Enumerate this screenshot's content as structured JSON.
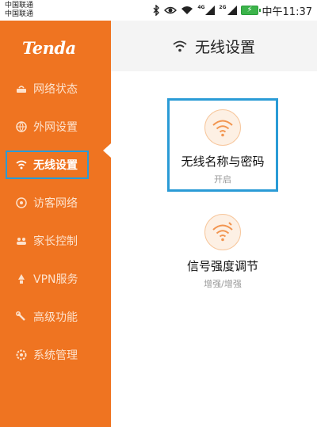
{
  "status_bar": {
    "carrier1": "中国联通",
    "carrier2": "中国联通",
    "net_tag1": "4G",
    "net_tag2": "2G",
    "time": "中午11:37",
    "icons": [
      "bluetooth-icon",
      "eye-icon",
      "wifi-icon",
      "signal-icon",
      "signal-icon",
      "battery-icon"
    ]
  },
  "sidebar": {
    "logo": "Tenda",
    "items": [
      {
        "label": "网络状态",
        "icon": "network-status-icon"
      },
      {
        "label": "外网设置",
        "icon": "globe-icon"
      },
      {
        "label": "无线设置",
        "icon": "wifi-icon",
        "active": true
      },
      {
        "label": "访客网络",
        "icon": "guest-icon"
      },
      {
        "label": "家长控制",
        "icon": "parents-icon"
      },
      {
        "label": "VPN服务",
        "icon": "vpn-icon"
      },
      {
        "label": "高级功能",
        "icon": "wrench-icon"
      },
      {
        "label": "系统管理",
        "icon": "gear-icon"
      }
    ]
  },
  "header": {
    "title": "无线设置"
  },
  "cards": [
    {
      "name": "无线名称与密码",
      "sub": "开启"
    },
    {
      "name": "信号强度调节",
      "sub": "增强/增强"
    }
  ],
  "colors": {
    "sidebar": "#ef7421",
    "highlight": "#2a9bd6",
    "header_bg": "#f4f4f4"
  }
}
